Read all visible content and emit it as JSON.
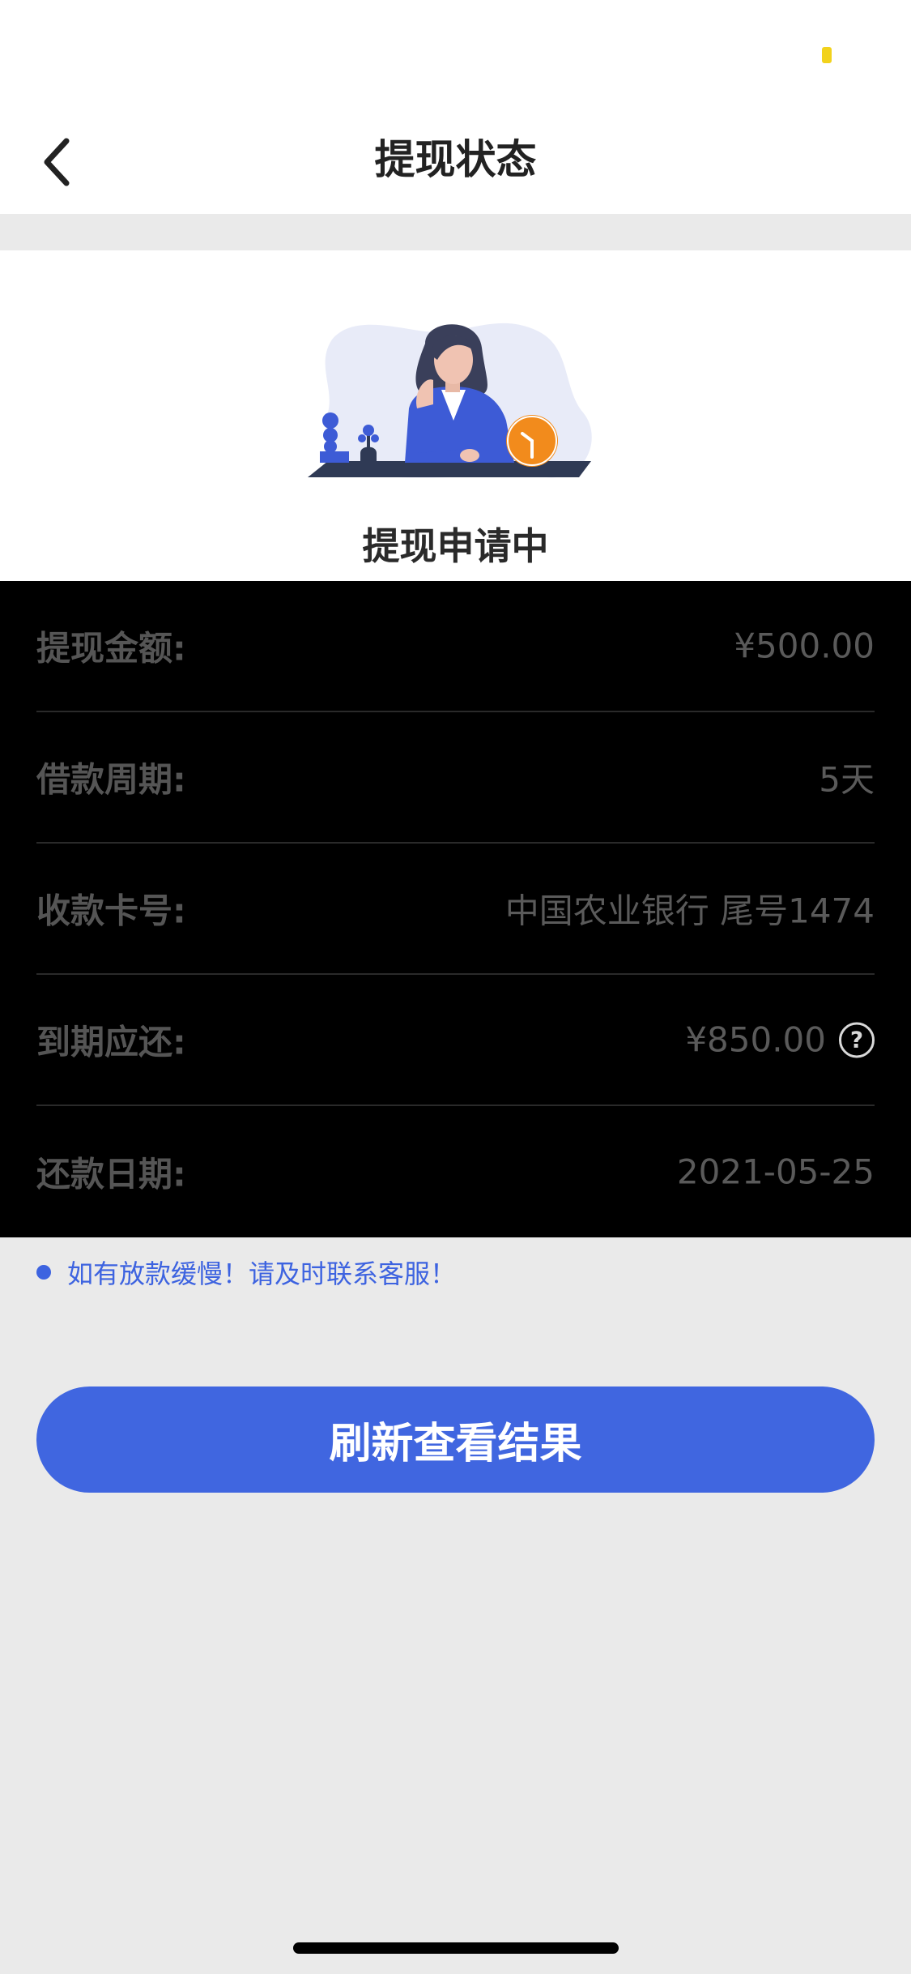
{
  "nav": {
    "title": "提现状态",
    "back_icon": "chevron-left-icon"
  },
  "status": {
    "text": "提现申请中",
    "illustration": "woman-waiting-clock-illustration"
  },
  "details": [
    {
      "label": "提现金额:",
      "value": "¥500.00"
    },
    {
      "label": "借款周期:",
      "value": "5天"
    },
    {
      "label": "收款卡号:",
      "value": "中国农业银行 尾号1474"
    },
    {
      "label": "到期应还:",
      "value": "¥850.00",
      "help_icon": "?"
    },
    {
      "label": "还款日期:",
      "value": "2021-05-25"
    }
  ],
  "notice": {
    "text": "如有放款缓慢！请及时联系客服！"
  },
  "refresh_button": {
    "label": "刷新查看结果"
  },
  "colors": {
    "accent": "#4066e0",
    "status_indicator": "#f2d21c",
    "clock": "#f28b1c"
  }
}
